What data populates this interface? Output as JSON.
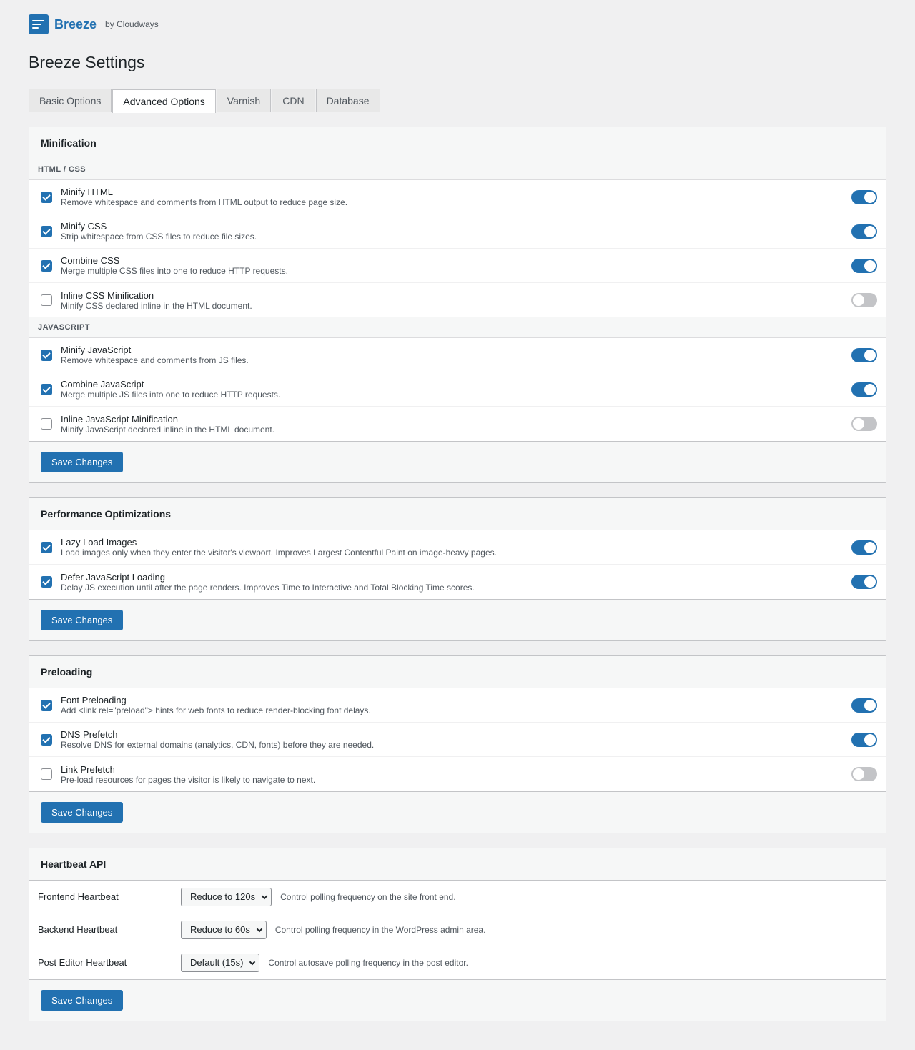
{
  "brand": {
    "name": "Breeze",
    "by": "by Cloudways",
    "icon": "breeze-logo-icon",
    "color": "#2271b1"
  },
  "page_title": "Breeze Settings",
  "tabs": [
    {
      "label": "Basic Options",
      "active": false
    },
    {
      "label": "Advanced Options",
      "active": true
    },
    {
      "label": "Varnish",
      "active": false
    },
    {
      "label": "CDN",
      "active": false
    },
    {
      "label": "Database",
      "active": false
    }
  ],
  "minification": {
    "title": "Minification",
    "groups": [
      {
        "label": "HTML / CSS",
        "items": [
          {
            "title": "Minify HTML",
            "desc": "Remove whitespace and comments from HTML output to reduce page size.",
            "checked": true
          },
          {
            "title": "Minify CSS",
            "desc": "Strip whitespace from CSS files to reduce file sizes.",
            "checked": true
          },
          {
            "title": "Combine CSS",
            "desc": "Merge multiple CSS files into one to reduce HTTP requests.",
            "checked": true
          },
          {
            "title": "Inline CSS Minification",
            "desc": "Minify CSS declared inline in the HTML document.",
            "checked": false
          }
        ]
      },
      {
        "label": "JavaScript",
        "items": [
          {
            "title": "Minify JavaScript",
            "desc": "Remove whitespace and comments from JS files.",
            "checked": true
          },
          {
            "title": "Combine JavaScript",
            "desc": "Merge multiple JS files into one to reduce HTTP requests.",
            "checked": true
          },
          {
            "title": "Inline JavaScript Minification",
            "desc": "Minify JavaScript declared inline in the HTML document.",
            "checked": false
          }
        ]
      }
    ],
    "save_label": "Save Changes"
  },
  "performance": {
    "title": "Performance Optimizations",
    "items": [
      {
        "title": "Lazy Load Images",
        "desc": "Load images only when they enter the visitor's viewport. Improves Largest Contentful Paint on image-heavy pages.",
        "checked": true
      },
      {
        "title": "Defer JavaScript Loading",
        "desc": "Delay JS execution until after the page renders. Improves Time to Interactive and Total Blocking Time scores.",
        "checked": true
      }
    ],
    "save_label": "Save Changes"
  },
  "preloading": {
    "title": "Preloading",
    "items": [
      {
        "title": "Font Preloading",
        "desc": "Add <link rel=\"preload\"> hints for web fonts to reduce render-blocking font delays.",
        "checked": true
      },
      {
        "title": "DNS Prefetch",
        "desc": "Resolve DNS for external domains (analytics, CDN, fonts) before they are needed.",
        "checked": true
      },
      {
        "title": "Link Prefetch",
        "desc": "Pre-load resources for pages the visitor is likely to navigate to next.",
        "checked": false
      }
    ],
    "save_label": "Save Changes"
  },
  "heartbeat": {
    "title": "Heartbeat API",
    "rows": [
      {
        "label": "Frontend Heartbeat",
        "value": "Reduce to 120s",
        "desc": "Control polling frequency on the site front end."
      },
      {
        "label": "Backend Heartbeat",
        "value": "Reduce to 60s",
        "desc": "Control polling frequency in the WordPress admin area."
      },
      {
        "label": "Post Editor Heartbeat",
        "value": "Default (15s)",
        "desc": "Control autosave polling frequency in the post editor."
      }
    ],
    "save_label": "Save Changes"
  }
}
